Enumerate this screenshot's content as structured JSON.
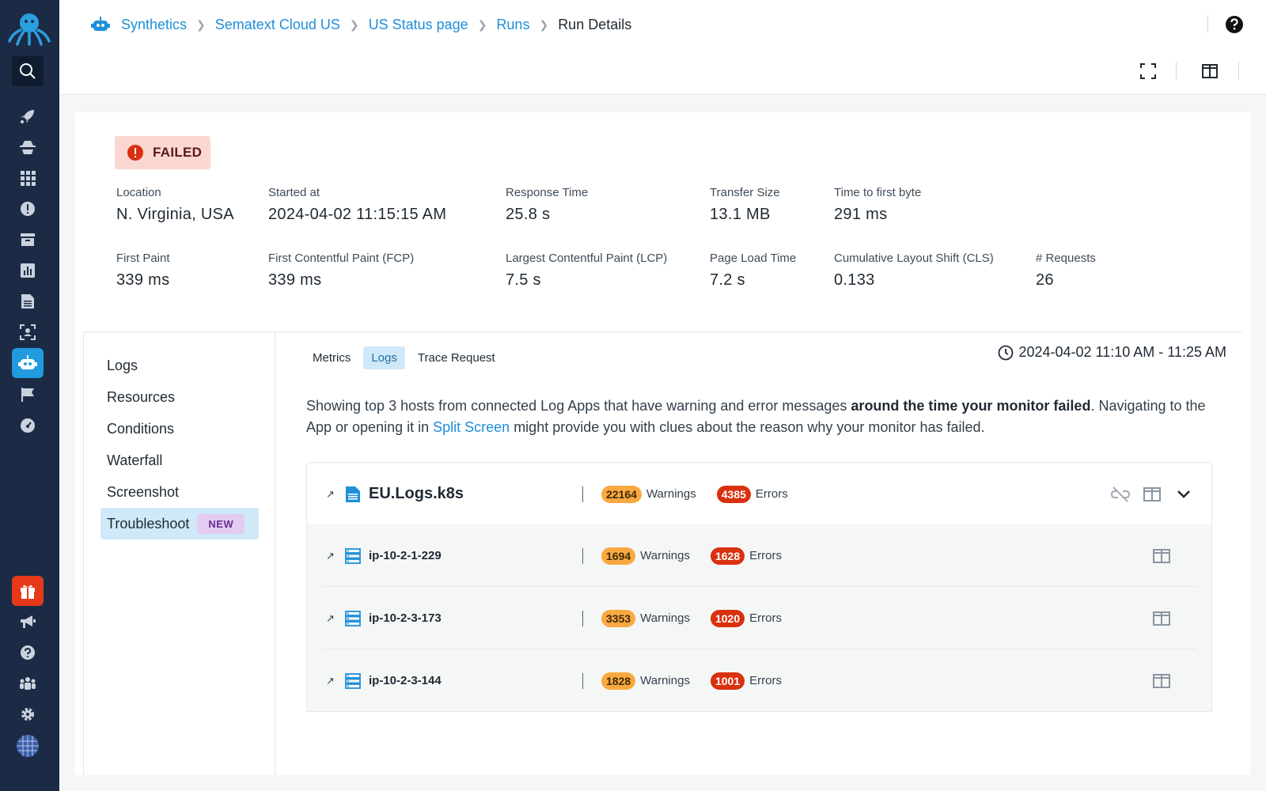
{
  "breadcrumb": {
    "items": [
      "Synthetics",
      "Sematext Cloud US",
      "US Status page",
      "Runs"
    ],
    "current": "Run Details"
  },
  "status": {
    "label": "FAILED"
  },
  "metrics": [
    {
      "label": "Location",
      "value": "N. Virginia, USA"
    },
    {
      "label": "Started at",
      "value": "2024-04-02 11:15:15 AM"
    },
    {
      "label": "Response Time",
      "value": "25.8 s"
    },
    {
      "label": "Transfer Size",
      "value": "13.1 MB"
    },
    {
      "label": "Time to first byte",
      "value": "291 ms"
    },
    {
      "label": "First Paint",
      "value": "339 ms"
    },
    {
      "label": "First Contentful Paint (FCP)",
      "value": "339 ms"
    },
    {
      "label": "Largest Contentful Paint (LCP)",
      "value": "7.5 s"
    },
    {
      "label": "Page Load Time",
      "value": "7.2 s"
    },
    {
      "label": "Cumulative Layout Shift (CLS)",
      "value": "0.133"
    },
    {
      "label": "# Requests",
      "value": "26"
    }
  ],
  "side_menu": {
    "items": [
      "Logs",
      "Resources",
      "Conditions",
      "Waterfall",
      "Screenshot",
      "Troubleshoot"
    ],
    "new_badge": "NEW"
  },
  "tabs": [
    "Metrics",
    "Logs",
    "Trace Request"
  ],
  "time_range": "2024-04-02 11:10 AM - 11:25 AM",
  "description": {
    "part1": "Showing top 3 hosts from connected Log Apps that have warning and error messages ",
    "bold": "around the time your monitor failed",
    "part2": ". Navigating to the App or opening it in ",
    "link": "Split Screen",
    "part3": " might provide you with clues about the reason why your monitor has failed."
  },
  "app": {
    "name": "EU.Logs.k8s",
    "warnings": "22164",
    "errors": "4385",
    "warnings_label": "Warnings",
    "errors_label": "Errors"
  },
  "hosts": [
    {
      "name": "ip-10-2-1-229",
      "warnings": "1694",
      "errors": "1628",
      "warnings_label": "Warnings",
      "errors_label": "Errors"
    },
    {
      "name": "ip-10-2-3-173",
      "warnings": "3353",
      "errors": "1020",
      "warnings_label": "Warnings",
      "errors_label": "Errors"
    },
    {
      "name": "ip-10-2-3-144",
      "warnings": "1828",
      "errors": "1001",
      "warnings_label": "Warnings",
      "errors_label": "Errors"
    }
  ],
  "icons": {
    "arrow": "↗"
  },
  "colors": {
    "nav_bg": "#1c2b45",
    "accent": "#1f9bde",
    "failed_bg": "#fbd7d2",
    "warning": "#f9a940",
    "error": "#d9310f"
  }
}
